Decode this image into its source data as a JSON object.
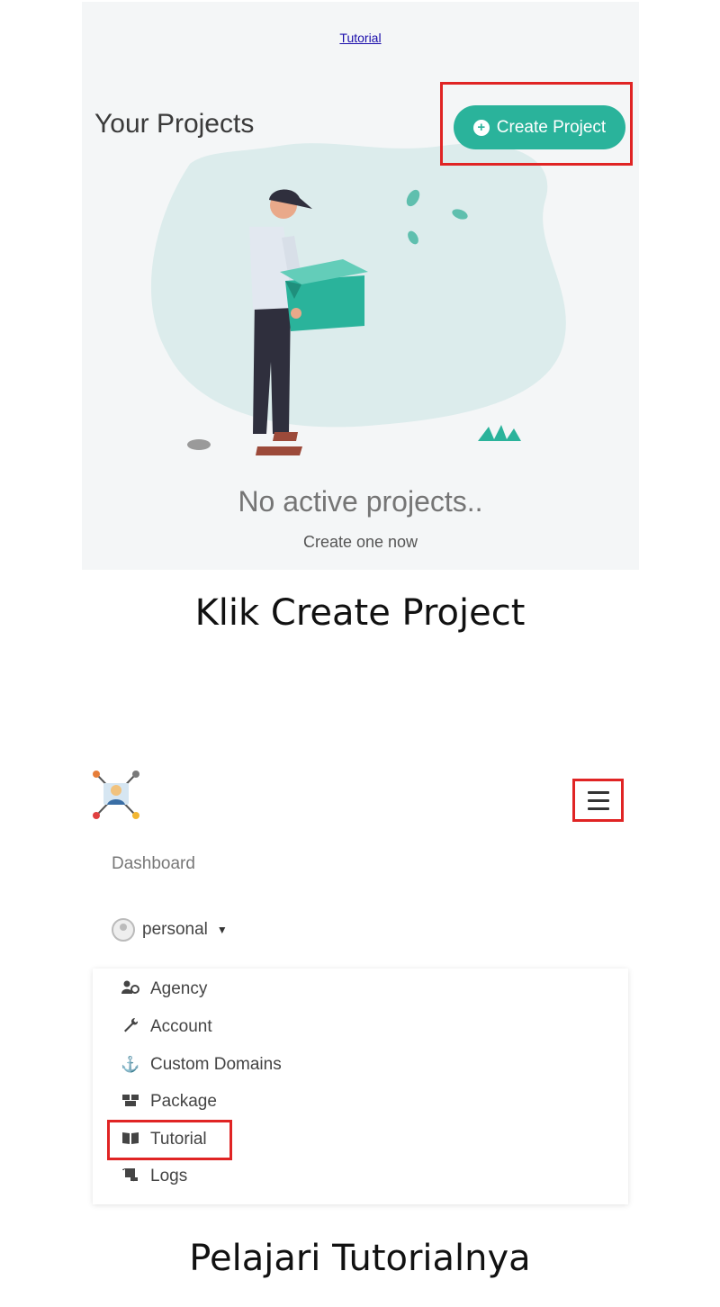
{
  "panel1": {
    "tutorial_link": "Tutorial",
    "title": "Your Projects",
    "create_button": "Create Project",
    "empty_title": "No active projects..",
    "empty_subtitle": "Create one now"
  },
  "caption1": "Klik Create Project",
  "panel2": {
    "dashboard_label": "Dashboard",
    "account_name": "personal",
    "menu_items": [
      {
        "label": "Agency",
        "icon": "user-group-icon"
      },
      {
        "label": "Account",
        "icon": "wrench-icon"
      },
      {
        "label": "Custom Domains",
        "icon": "anchor-icon"
      },
      {
        "label": "Package",
        "icon": "boxes-icon"
      },
      {
        "label": "Tutorial",
        "icon": "book-icon"
      },
      {
        "label": "Logs",
        "icon": "scroll-icon"
      }
    ]
  },
  "caption2": "Pelajari Tutorialnya",
  "colors": {
    "accent": "#2ab39b",
    "highlight": "#e02424",
    "panel_bg": "#f4f6f7"
  }
}
